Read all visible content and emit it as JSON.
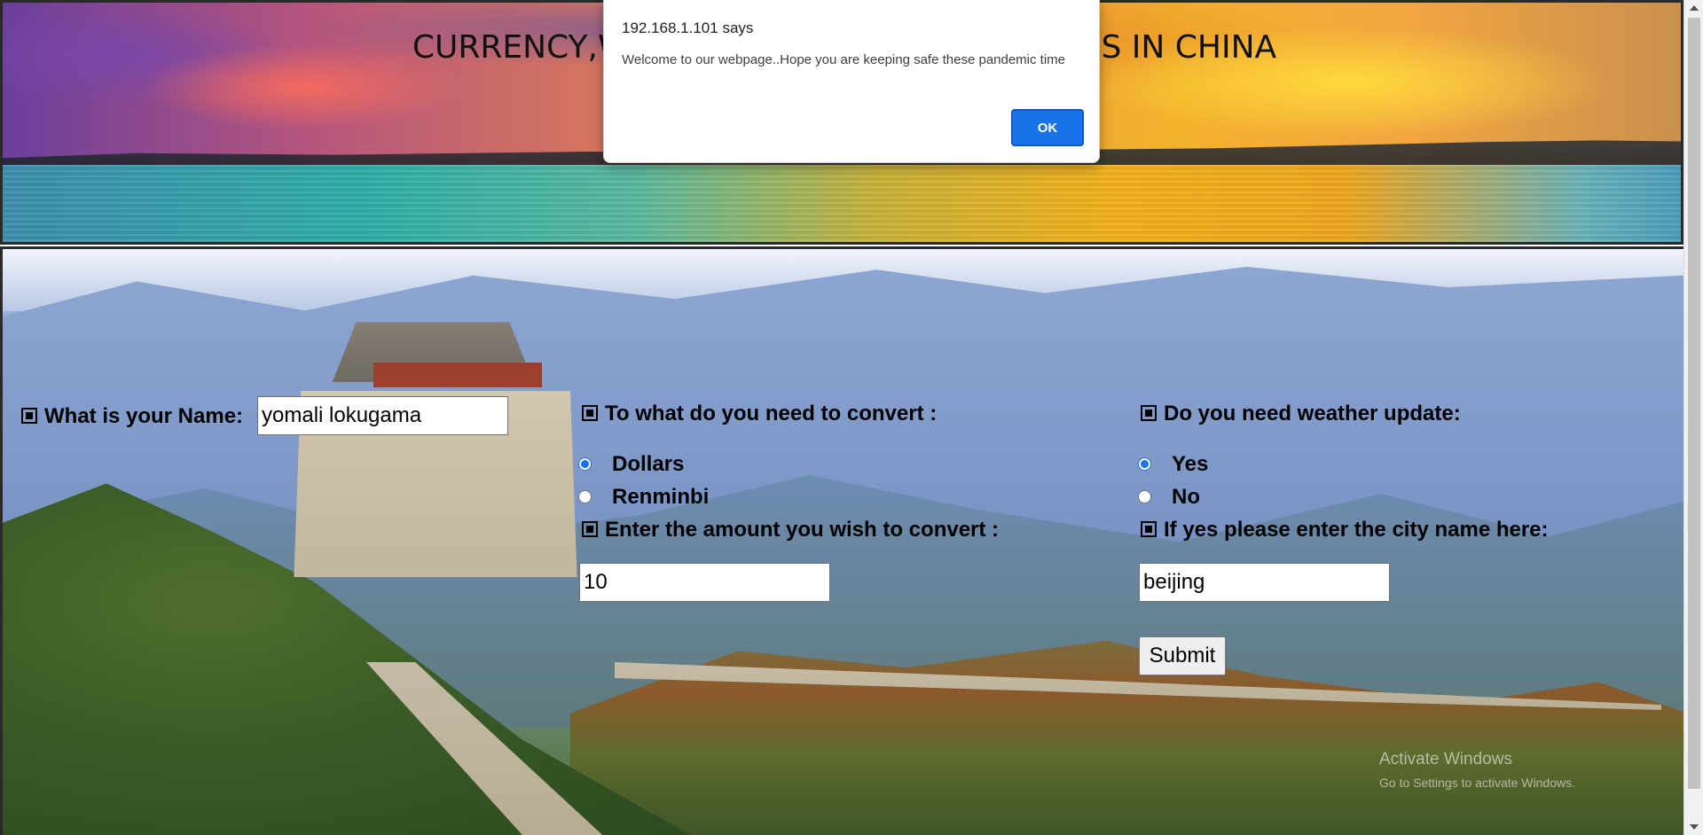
{
  "banner": {
    "title": "CURRENCY,WEATHER AND OTHER SERVICES IN CHINA"
  },
  "form": {
    "name_label": "What is your Name:",
    "name_value": "yomali lokugama",
    "convert_label": "To what do you need to convert :",
    "convert_options": [
      {
        "label": "Dollars",
        "selected": true
      },
      {
        "label": "Renminbi",
        "selected": false
      }
    ],
    "amount_label": "Enter the amount you wish to convert :",
    "amount_value": "10",
    "weather_label": "Do you need weather update:",
    "weather_options": [
      {
        "label": "Yes",
        "selected": true
      },
      {
        "label": "No",
        "selected": false
      }
    ],
    "city_label": "If yes please enter the city name here:",
    "city_value": "beijing",
    "submit_label": "Submit"
  },
  "alert": {
    "title": "192.168.1.101 says",
    "message": "Welcome to our webpage..Hope you are keeping safe these pandemic time",
    "ok_label": "OK"
  },
  "watermark": {
    "line1": "Activate Windows",
    "line2": "Go to Settings to activate Windows."
  },
  "colors": {
    "accent": "#1a73e8",
    "text": "#000000"
  },
  "icons": {
    "bullet": "square-bullet-icon"
  }
}
